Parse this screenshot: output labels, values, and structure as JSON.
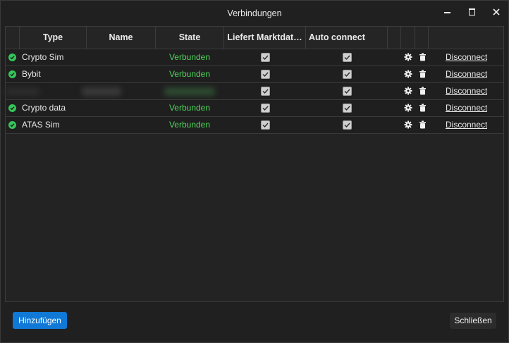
{
  "window": {
    "title": "Verbindungen"
  },
  "table": {
    "columns": [
      {
        "label": ""
      },
      {
        "label": "Type"
      },
      {
        "label": "Name"
      },
      {
        "label": "State"
      },
      {
        "label": "Liefert Marktdat…"
      },
      {
        "label": "Auto connect"
      },
      {
        "label": ""
      },
      {
        "label": ""
      },
      {
        "label": ""
      }
    ],
    "rows": [
      {
        "type": "Crypto Sim",
        "name": "",
        "state": "Verbunden",
        "market_data": true,
        "auto_connect": true,
        "action": "Disconnect",
        "status": "connected",
        "redacted": false
      },
      {
        "type": "Bybit",
        "name": "",
        "state": "Verbunden",
        "market_data": true,
        "auto_connect": true,
        "action": "Disconnect",
        "status": "connected",
        "redacted": false
      },
      {
        "type": "",
        "name": "",
        "state": "",
        "market_data": true,
        "auto_connect": true,
        "action": "Disconnect",
        "status": "unknown",
        "redacted": true
      },
      {
        "type": "Crypto data",
        "name": "",
        "state": "Verbunden",
        "market_data": true,
        "auto_connect": true,
        "action": "Disconnect",
        "status": "connected",
        "redacted": false
      },
      {
        "type": "ATAS Sim",
        "name": "",
        "state": "Verbunden",
        "market_data": true,
        "auto_connect": true,
        "action": "Disconnect",
        "status": "connected",
        "redacted": false
      }
    ]
  },
  "footer": {
    "add_label": "Hinzufügen",
    "close_label": "Schließen"
  },
  "colors": {
    "accent": "#1078d6",
    "connected_text": "#4fd75c",
    "status_ok": "#35c65b",
    "background": "#202020"
  },
  "icons": {
    "status": "check-circle-icon",
    "settings": "gear-icon",
    "delete": "trash-icon",
    "minimize": "minimize-icon",
    "maximize": "maximize-icon",
    "close": "close-icon"
  }
}
